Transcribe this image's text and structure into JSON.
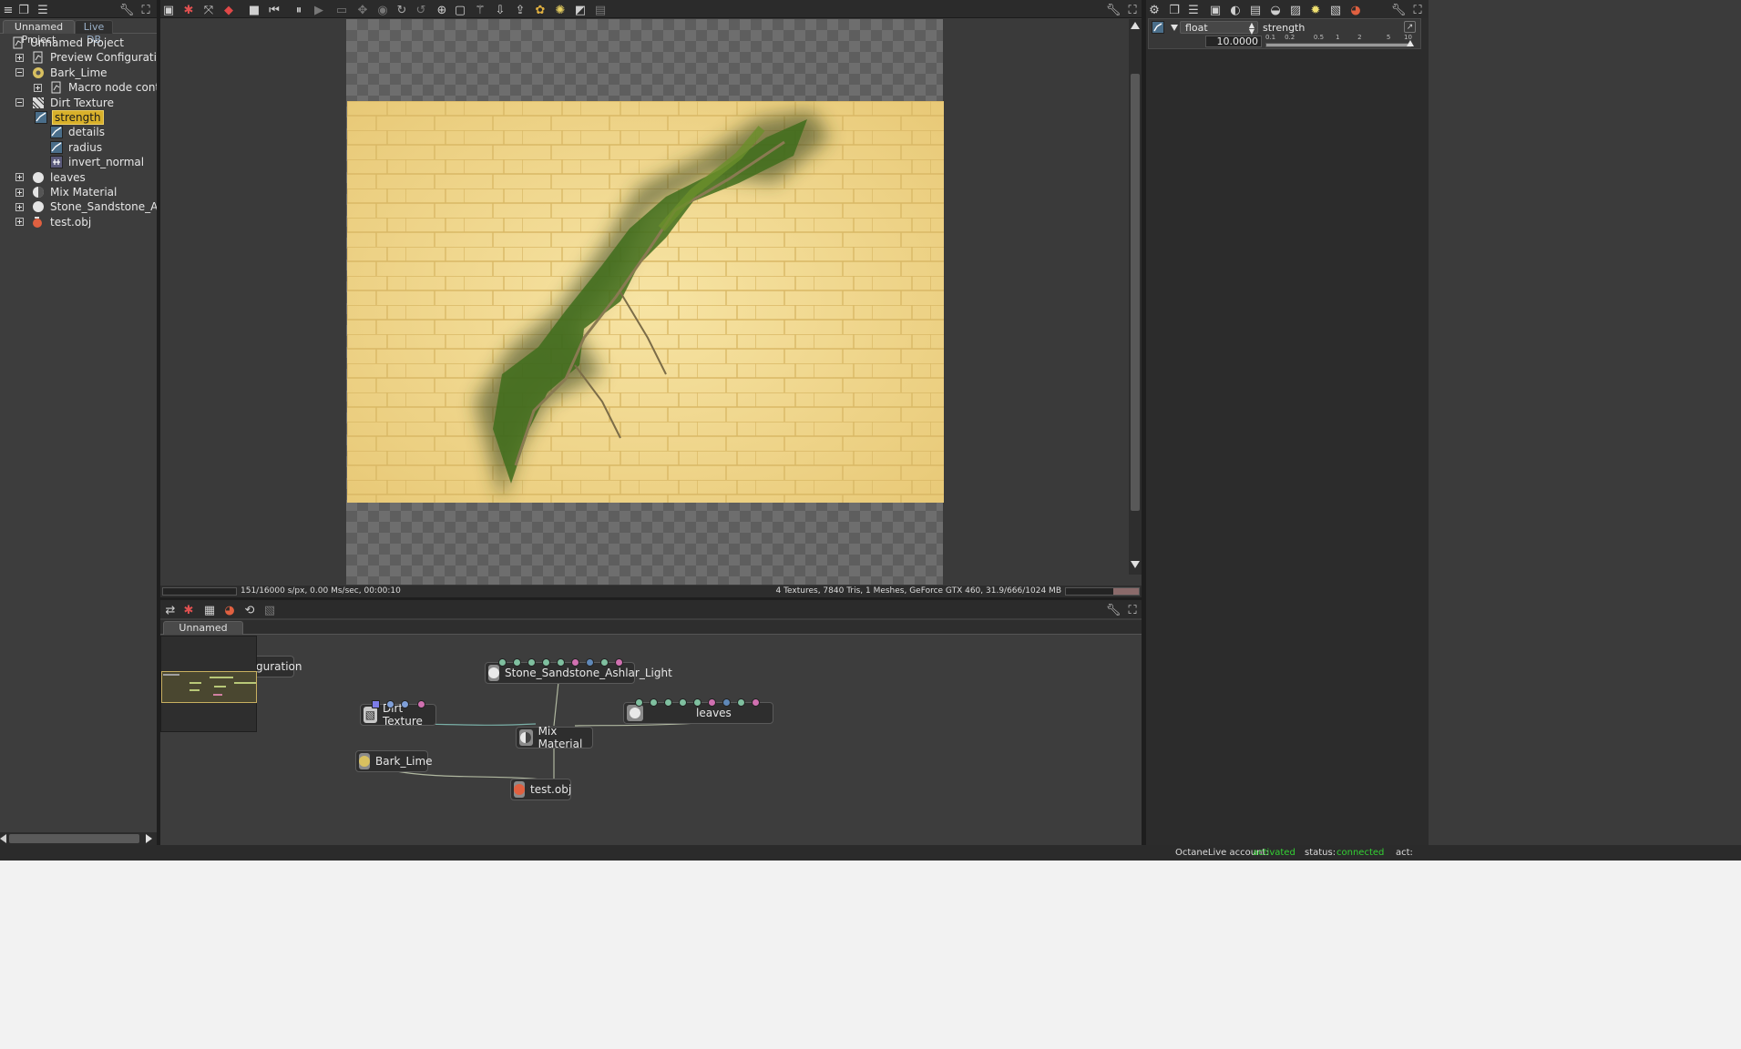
{
  "left_panel": {
    "tabs": [
      "Unnamed Project",
      "Live DB"
    ],
    "tree": [
      {
        "label": "Unnamed Project",
        "icon": "project-icon",
        "expander": "none",
        "level": 0
      },
      {
        "label": "Preview Configuration",
        "icon": "config-icon",
        "expander": "closed",
        "level": 1
      },
      {
        "label": "Bark_Lime",
        "icon": "material-icon",
        "expander": "open",
        "level": 1
      },
      {
        "label": "Macro node contents",
        "icon": "macro-icon",
        "expander": "closed",
        "level": 2
      },
      {
        "label": "Dirt Texture",
        "icon": "dirt-texture-icon",
        "expander": "open",
        "level": 1
      },
      {
        "label": "strength",
        "icon": "float-icon",
        "expander": "none",
        "level": 2,
        "selected": true
      },
      {
        "label": "details",
        "icon": "float-icon",
        "expander": "none",
        "level": 2
      },
      {
        "label": "radius",
        "icon": "float-icon",
        "expander": "none",
        "level": 2
      },
      {
        "label": "invert_normal",
        "icon": "bool-icon",
        "expander": "none",
        "level": 2
      },
      {
        "label": "leaves",
        "icon": "sphere-icon",
        "expander": "closed",
        "level": 1
      },
      {
        "label": "Mix Material",
        "icon": "mix-icon",
        "expander": "closed",
        "level": 1
      },
      {
        "label": "Stone_Sandstone_Ashlar_Light",
        "icon": "sphere-icon",
        "expander": "closed",
        "level": 1
      },
      {
        "label": "test.obj",
        "icon": "mesh-icon",
        "expander": "closed",
        "level": 1
      }
    ]
  },
  "viewport": {
    "status_left": "151/16000 s/px, 0.00 Ms/sec, 00:00:10",
    "status_right": "4 Textures, 7840 Tris, 1 Meshes, GeForce GTX 460, 31.9/666/1024 MB"
  },
  "node_editor": {
    "tab": "Unnamed Project",
    "nodes": {
      "preview_config": "guration",
      "stone": "Stone_Sandstone_Ashlar_Light",
      "dirt": "Dirt Texture",
      "leaves": "leaves",
      "mix": "Mix Material",
      "bark": "Bark_Lime",
      "testobj": "test.obj"
    }
  },
  "inspector": {
    "type_value": "float",
    "param_name": "strength",
    "value": "10.0000",
    "scale_ticks": [
      "0.1",
      "0.2",
      "0.5",
      "1",
      "2",
      "5",
      "10"
    ],
    "slider_level": 1.0
  },
  "statusbar": {
    "account_label": "OctaneLive account:",
    "account_value": "activated",
    "status_label": "status:",
    "status_value": "connected",
    "act_label": "act:"
  },
  "colors": {
    "accent_selected": "#d8b02a",
    "status_green": "#33d133",
    "panel_bg": "#3b3b3b",
    "toolbar_bg": "#2a2a2a"
  }
}
